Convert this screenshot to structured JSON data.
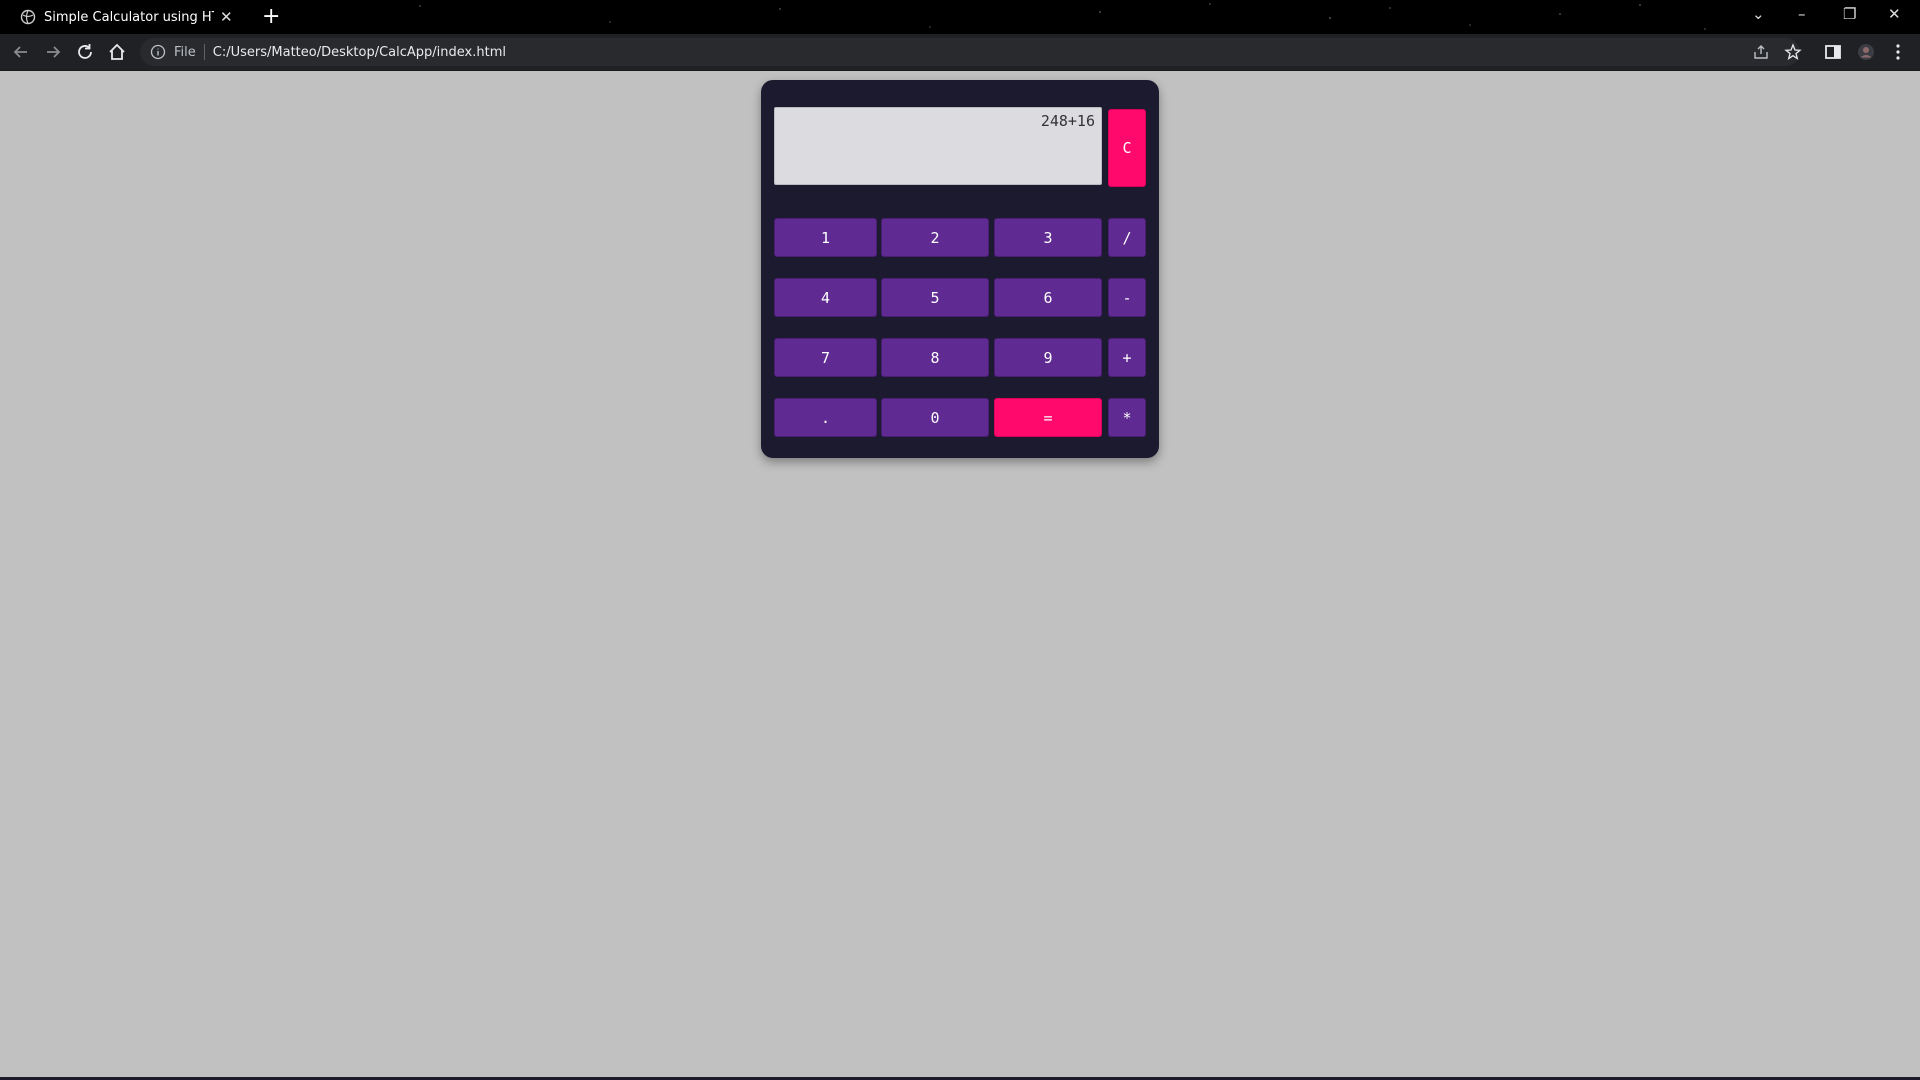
{
  "browser": {
    "tab_title": "Simple Calculator using HTML, C",
    "url_scheme_label": "File",
    "url": "C:/Users/Matteo/Desktop/CalcApp/index.html"
  },
  "calculator": {
    "display_value": "248+16",
    "buttons": {
      "clear": "C",
      "one": "1",
      "two": "2",
      "three": "3",
      "divide": "/",
      "four": "4",
      "five": "5",
      "six": "6",
      "subtract": "-",
      "seven": "7",
      "eight": "8",
      "nine": "9",
      "add": "+",
      "decimal": ".",
      "zero": "0",
      "equals": "=",
      "multiply": "*"
    }
  },
  "colors": {
    "page_background": "#c1c1c1",
    "calculator_body": "#1b1a2e",
    "button_purple": "#5f2a91",
    "button_pink": "#ff0a6c",
    "display_background": "#dcdbe0"
  }
}
